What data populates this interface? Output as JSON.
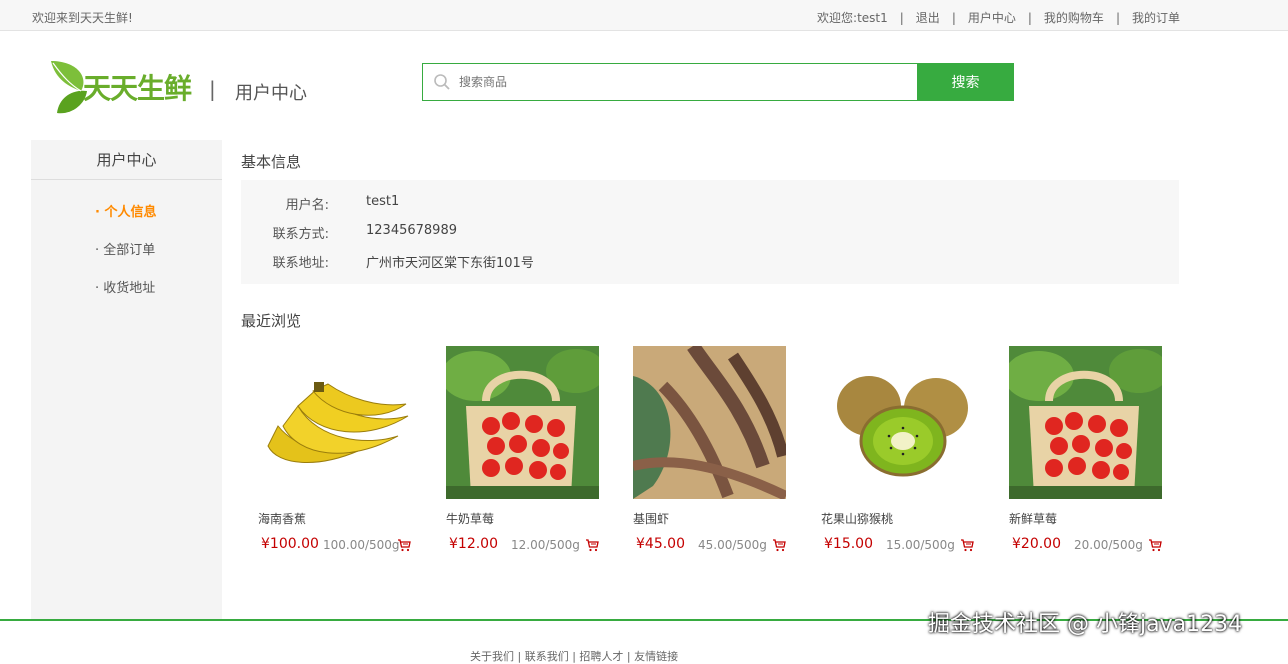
{
  "topbar": {
    "welcome": "欢迎来到天天生鲜!",
    "greeting_prefix": "欢迎您:",
    "username": "test1",
    "logout": "退出",
    "user_center": "用户中心",
    "cart": "我的购物车",
    "orders": "我的订单"
  },
  "header": {
    "logo_text": "天天生鲜",
    "divider": "|",
    "section": "用户中心",
    "search_placeholder": "搜索商品",
    "search_button": "搜索"
  },
  "sidebar": {
    "title": "用户中心",
    "items": [
      {
        "label": "· 个人信息",
        "active": true
      },
      {
        "label": "· 全部订单",
        "active": false
      },
      {
        "label": "· 收货地址",
        "active": false
      }
    ]
  },
  "basic_info": {
    "title": "基本信息",
    "rows": [
      {
        "label": "用户名:",
        "value": "test1"
      },
      {
        "label": "联系方式:",
        "value": "12345678989"
      },
      {
        "label": "联系地址:",
        "value": "广州市天河区棠下东街101号"
      }
    ]
  },
  "recent": {
    "title": "最近浏览",
    "products": [
      {
        "name": "海南香蕉",
        "price": "¥100.00",
        "unit": "100.00/500g",
        "image": "banana"
      },
      {
        "name": "牛奶草莓",
        "price": "¥12.00",
        "unit": "12.00/500g",
        "image": "strawberry"
      },
      {
        "name": "基围虾",
        "price": "¥45.00",
        "unit": "45.00/500g",
        "image": "shrimp"
      },
      {
        "name": "花果山猕猴桃",
        "price": "¥15.00",
        "unit": "15.00/500g",
        "image": "kiwi"
      },
      {
        "name": "新鲜草莓",
        "price": "¥20.00",
        "unit": "20.00/500g",
        "image": "strawberry"
      }
    ]
  },
  "footer": {
    "links": "关于我们 | 联系我们 | 招聘人才 | 友情链接"
  },
  "watermark": "掘金技术社区 @ 小锋java1234",
  "colors": {
    "brand_green": "#37ab40",
    "active_orange": "#ff8a00",
    "price_red": "#c40000"
  }
}
